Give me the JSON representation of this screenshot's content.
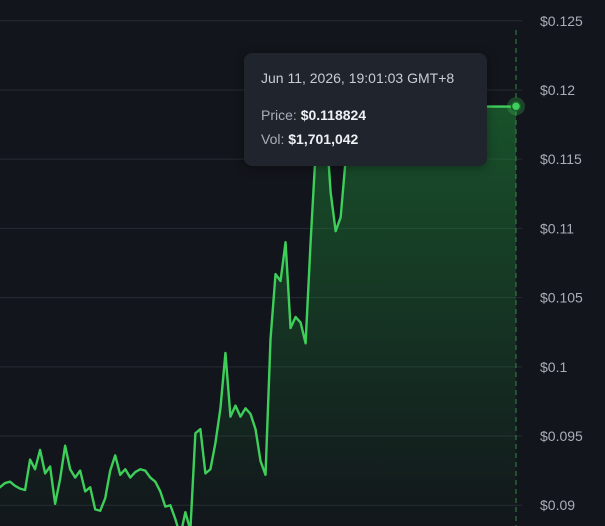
{
  "colors": {
    "background": "#12151b",
    "grid": "#262b33",
    "line": "#3ecf5a",
    "area_top": "#1f8f3a",
    "crosshair": "#2f8a44",
    "tick_text": "#a9aeb8",
    "tooltip_bg": "#1f242d"
  },
  "tooltip": {
    "date": "Jun 11, 2026, 19:01:03 GMT+8",
    "price_label": "Price:",
    "price_value": "$0.118824",
    "vol_label": "Vol:",
    "vol_value": "$1,701,042"
  },
  "chart_data": {
    "type": "area",
    "title": "",
    "xlabel": "",
    "ylabel": "",
    "ylim": [
      0.0885,
      0.1265
    ],
    "y_ticks": [
      {
        "value": 0.125,
        "label": "$0.125"
      },
      {
        "value": 0.12,
        "label": "$0.12"
      },
      {
        "value": 0.115,
        "label": "$0.115"
      },
      {
        "value": 0.11,
        "label": "$0.11"
      },
      {
        "value": 0.105,
        "label": "$0.105"
      },
      {
        "value": 0.1,
        "label": "$0.1"
      },
      {
        "value": 0.095,
        "label": "$0.095"
      },
      {
        "value": 0.09,
        "label": "$0.09"
      }
    ],
    "grid": true,
    "y_axis_position": "right",
    "highlight_index": 103,
    "series": [
      {
        "values": [
          0.0913,
          0.0916,
          0.0917,
          0.0914,
          0.0912,
          0.0911,
          0.0933,
          0.0926,
          0.094,
          0.0923,
          0.0928,
          0.0901,
          0.0919,
          0.0943,
          0.0926,
          0.092,
          0.0925,
          0.091,
          0.0913,
          0.0897,
          0.0896,
          0.0905,
          0.0925,
          0.0936,
          0.0922,
          0.0926,
          0.092,
          0.0924,
          0.0926,
          0.0925,
          0.092,
          0.0917,
          0.091,
          0.0899,
          0.09,
          0.089,
          0.0878,
          0.0895,
          0.0882,
          0.0952,
          0.0955,
          0.0923,
          0.0926,
          0.0945,
          0.097,
          0.101,
          0.0964,
          0.0972,
          0.0964,
          0.097,
          0.0966,
          0.0955,
          0.0932,
          0.0922,
          0.102,
          0.1067,
          0.1062,
          0.109,
          0.1028,
          0.1036,
          0.1032,
          0.1017,
          0.109,
          0.1155,
          0.122,
          0.118,
          0.1126,
          0.1098,
          0.1108,
          0.115,
          0.118,
          0.117,
          0.1172,
          0.117,
          0.1175,
          0.1178,
          0.1179,
          0.118,
          0.1177,
          0.1183,
          0.1185,
          0.1188,
          0.119,
          0.1188,
          0.1189,
          0.1188,
          0.1188,
          0.1188,
          0.1188,
          0.1188,
          0.1188,
          0.1188,
          0.1188,
          0.1188,
          0.1188,
          0.1188,
          0.1188,
          0.1188,
          0.1188,
          0.1188,
          0.1188,
          0.1188,
          0.1188,
          0.118824
        ]
      }
    ]
  }
}
